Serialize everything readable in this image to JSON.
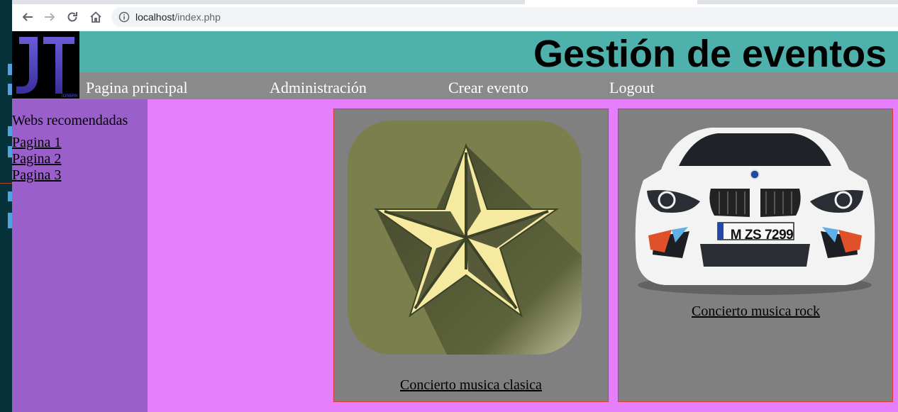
{
  "browser": {
    "url_host": "localhost",
    "url_path": "/index.php",
    "back_icon": "arrow-left-icon",
    "forward_icon": "arrow-right-icon",
    "reload_icon": "reload-icon",
    "home_icon": "home-icon",
    "info_icon": "info-icon"
  },
  "header": {
    "title": "Gestión de eventos",
    "logo_text": "JT",
    "logo_subtext": "IORBRK",
    "bg_color": "#4fb1ab"
  },
  "menu": {
    "items": [
      {
        "label": "Pagina principal"
      },
      {
        "label": "Administración"
      },
      {
        "label": "Crear evento"
      },
      {
        "label": "Logout"
      }
    ]
  },
  "sidebar": {
    "heading": "Webs recomendadas",
    "links": [
      {
        "label": "Pagina 1"
      },
      {
        "label": "Pagina 2"
      },
      {
        "label": "Pagina 3"
      }
    ]
  },
  "events": [
    {
      "title": "Concierto musica clasica",
      "image": "star-badge-image"
    },
    {
      "title": "Concierto musica rock",
      "image": "white-car-image",
      "plate": "M ZS 7299"
    }
  ]
}
